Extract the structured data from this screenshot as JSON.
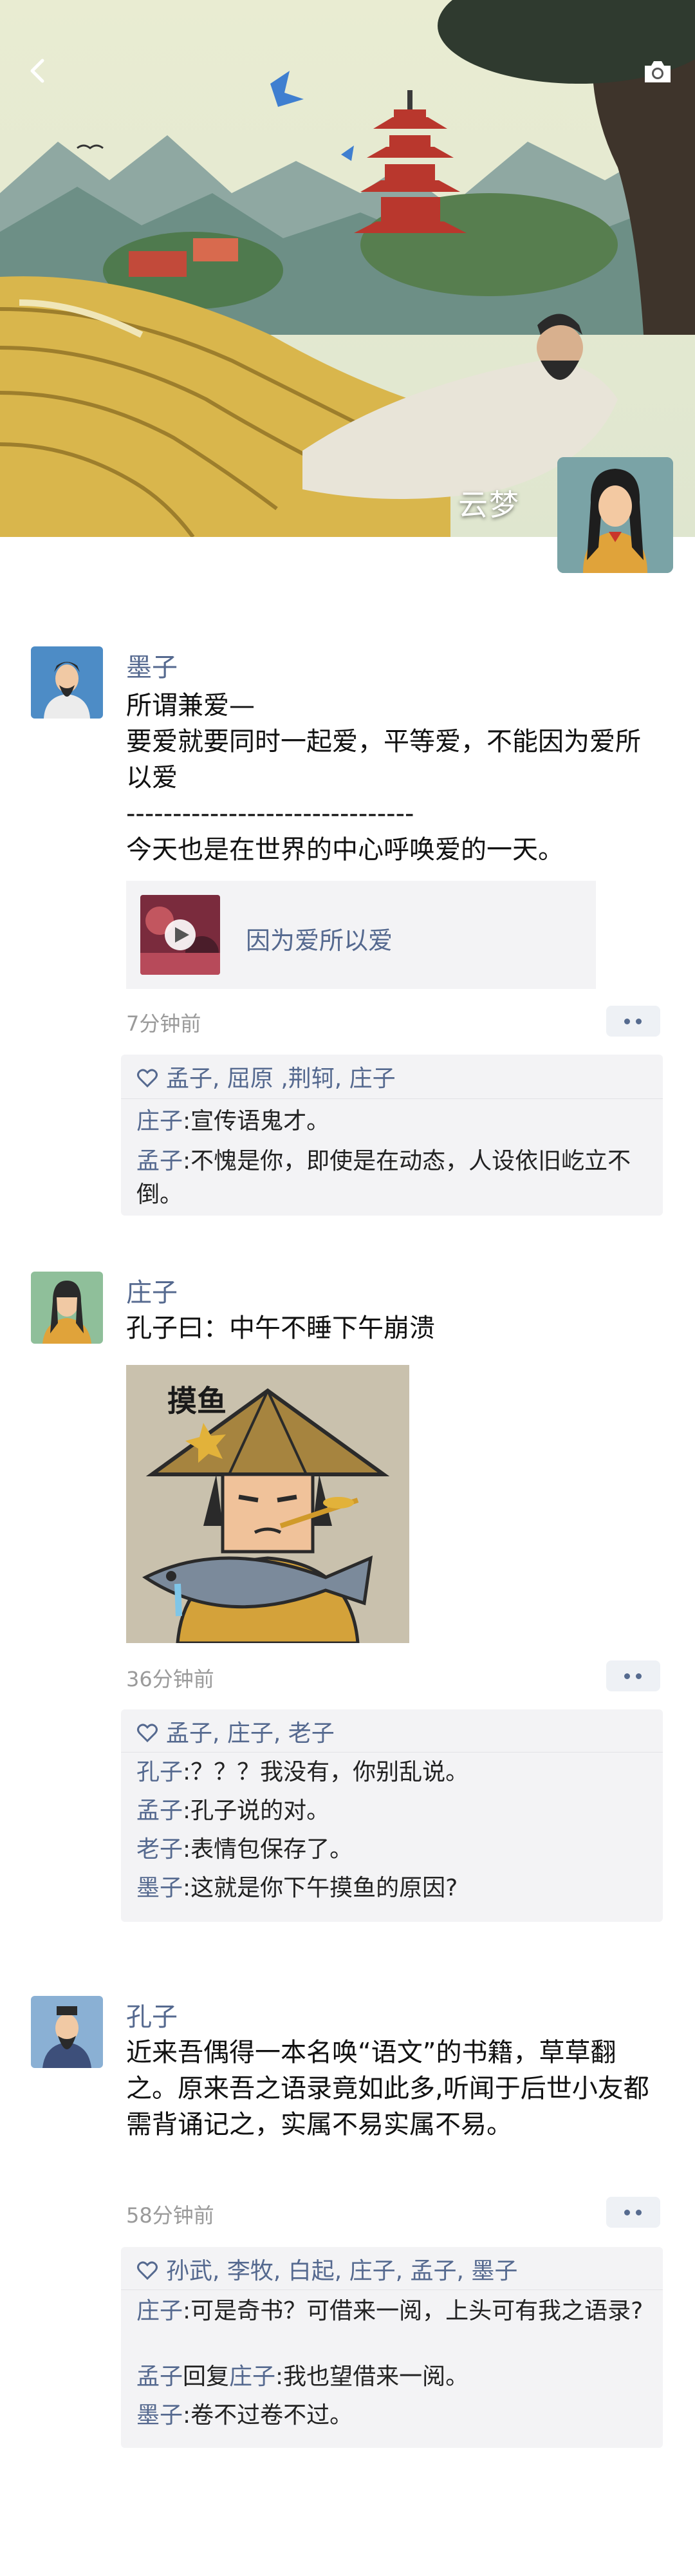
{
  "profile": {
    "name": "云梦"
  },
  "posts": [
    {
      "author": "墨子",
      "text": "所谓兼爱—\n要爱就要同时一起爱，平等爱，不能因为爱所以爱\n-------------------------------\n今天也是在世界的中心呼唤爱的一天。",
      "music": {
        "title": "因为爱所以爱"
      },
      "time": "7分钟前",
      "likes": "孟子, 屈原 ,荆轲, 庄子",
      "comments": [
        {
          "name": "庄子",
          "text": ":宣传语鬼才。"
        },
        {
          "name": "孟子",
          "text": ":不愧是你，即使是在动态，人设依旧屹立不倒。"
        }
      ]
    },
    {
      "author": "庄子",
      "text": "孔子曰：中午不睡下午崩溃",
      "image": {
        "label": "摸鱼"
      },
      "time": "36分钟前",
      "likes": "孟子, 庄子, 老子",
      "comments": [
        {
          "name": "孔子",
          "text": ":？？？我没有，你别乱说。"
        },
        {
          "name": "孟子",
          "text": ":孔子说的对。"
        },
        {
          "name": "老子",
          "text": ":表情包保存了。"
        },
        {
          "name": "墨子",
          "text": ":这就是你下午摸鱼的原因?"
        }
      ]
    },
    {
      "author": "孔子",
      "text": "近来吾偶得一本名唤“语文”的书籍，草草翻之。原来吾之语录竟如此多,听闻于后世小友都需背诵记之，实属不易实属不易。",
      "time": "58分钟前",
      "likes": "孙武, 李牧, 白起, 庄子, 孟子, 墨子",
      "comments": [
        {
          "name": "庄子",
          "text": ":可是奇书？可借来一阅，上头可有我之语录?"
        },
        {
          "name": "孟子",
          "reply_word": "回复",
          "reply_to": "庄子",
          "text": ":我也望借来一阅。"
        },
        {
          "name": "墨子",
          "text": ":卷不过卷不过。"
        }
      ]
    }
  ]
}
